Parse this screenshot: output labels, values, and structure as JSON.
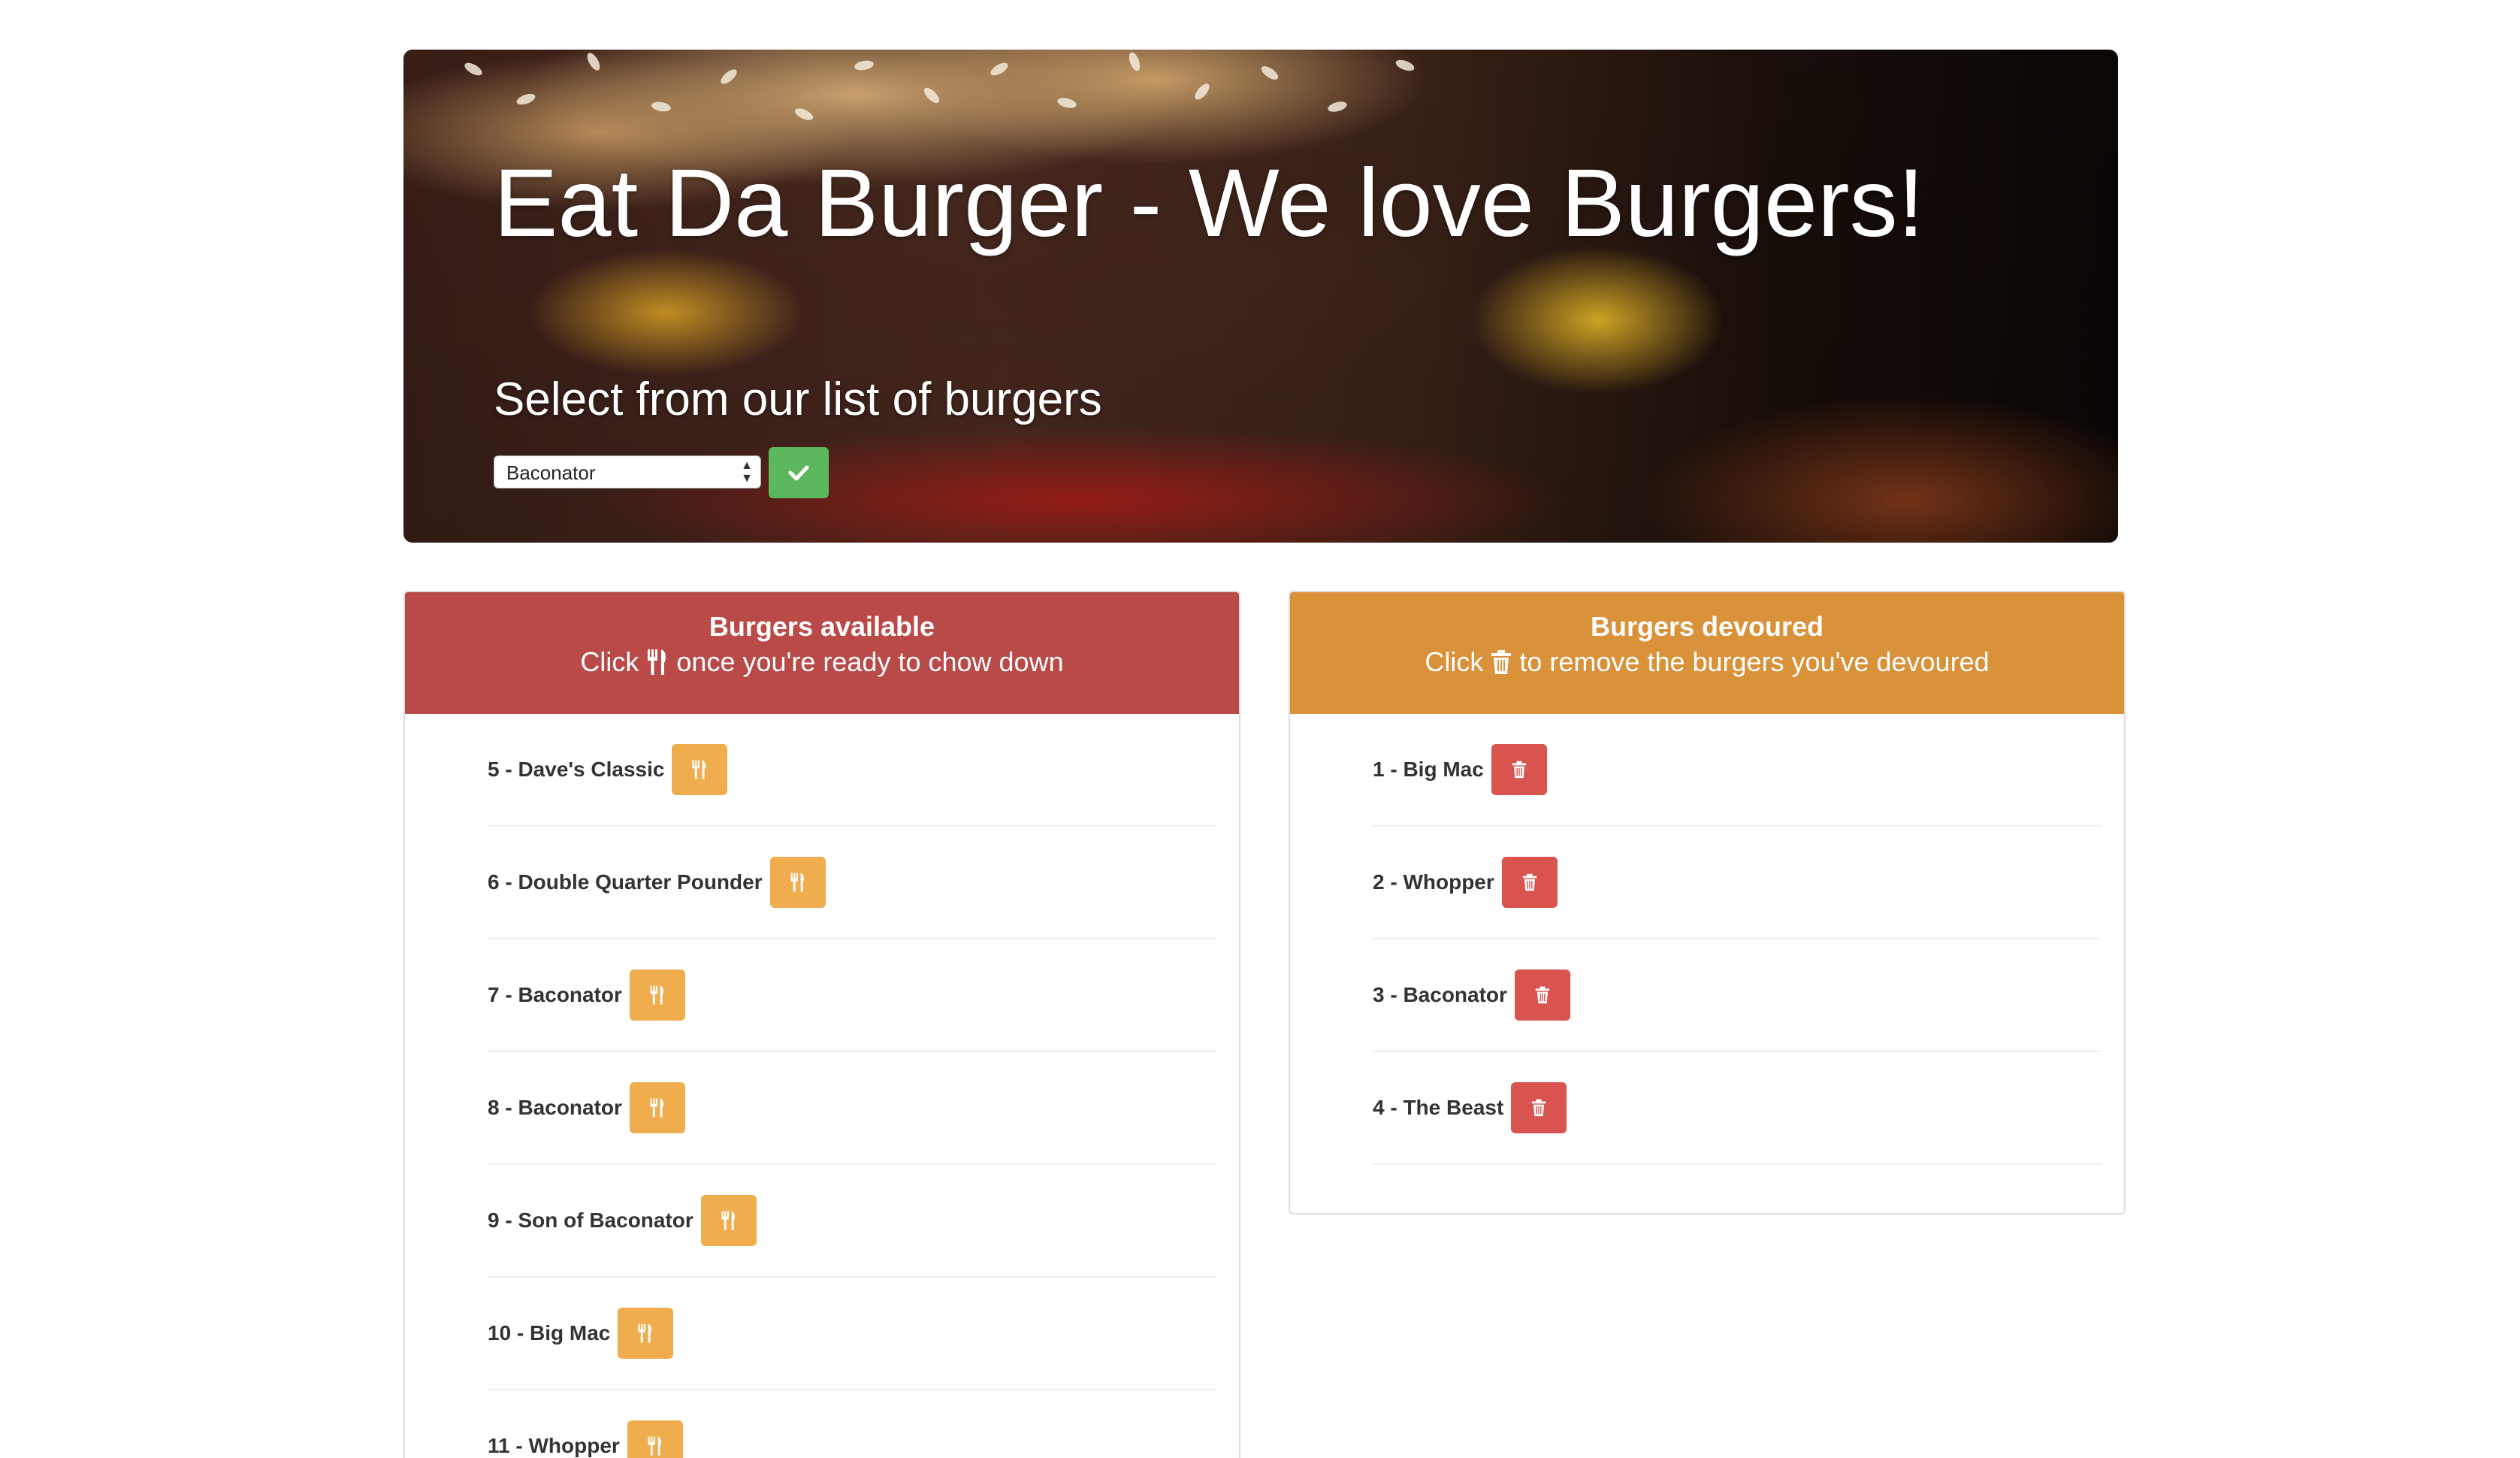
{
  "hero": {
    "title": "Eat Da Burger - We love Burgers!",
    "subtitle": "Select from our list of burgers",
    "select": {
      "selected": "Baconator"
    },
    "submit_icon": "check-icon"
  },
  "available": {
    "title": "Burgers available",
    "desc_before": "Click",
    "desc_icon": "utensils-icon",
    "desc_after": "once you're ready to chow down",
    "items": [
      {
        "label": "5 - Dave's Classic"
      },
      {
        "label": "6 - Double Quarter Pounder"
      },
      {
        "label": "7 - Baconator"
      },
      {
        "label": "8 - Baconator"
      },
      {
        "label": "9 - Son of Baconator"
      },
      {
        "label": "10 - Big Mac"
      },
      {
        "label": "11 - Whopper"
      }
    ]
  },
  "devoured": {
    "title": "Burgers devoured",
    "desc_before": "Click",
    "desc_icon": "trash-icon",
    "desc_after": "to remove the burgers you've devoured",
    "items": [
      {
        "label": "1 - Big Mac"
      },
      {
        "label": "2 - Whopper"
      },
      {
        "label": "3 - Baconator"
      },
      {
        "label": "4 - The Beast"
      }
    ]
  },
  "colors": {
    "available_header": "#b94a48",
    "devoured_header": "#d9923a",
    "eat_button": "#f0ad4e",
    "delete_button": "#d9534f",
    "submit_button": "#5cb85c"
  }
}
